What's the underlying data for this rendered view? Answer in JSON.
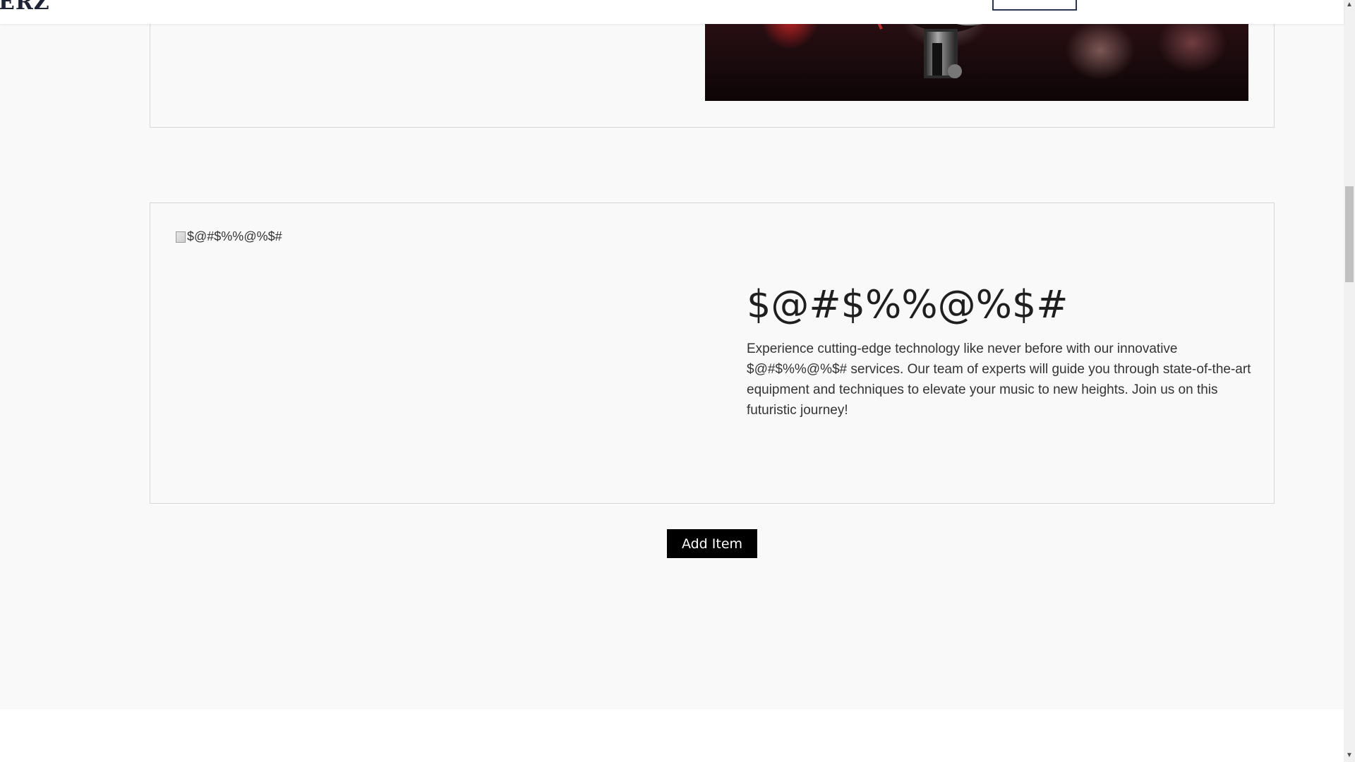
{
  "header": {
    "logo_text": "ERZ",
    "nav_link_1": "",
    "nav_link_2": ""
  },
  "cards": [
    {
      "image_icon": "microphone-photo"
    },
    {
      "image_alt": "$@#$%%@%$#",
      "title": "$@#$%%@%$#",
      "description": "Experience cutting-edge technology like never before with our innovative $@#$%%@%$# services. Our team of experts will guide you through state-of-the-art equipment and techniques to elevate your music to new heights. Join us on this futuristic journey!"
    }
  ],
  "actions": {
    "add_item_label": "Add Item"
  },
  "scrollbar": {
    "up_icon": "arrow-up-icon",
    "down_icon": "arrow-down-icon"
  },
  "colors": {
    "page_background": "#f9f9f9",
    "card_border": "#d6d6d6",
    "button_background": "#000000",
    "button_text": "#ffffff",
    "logo_color": "#1e2436"
  }
}
